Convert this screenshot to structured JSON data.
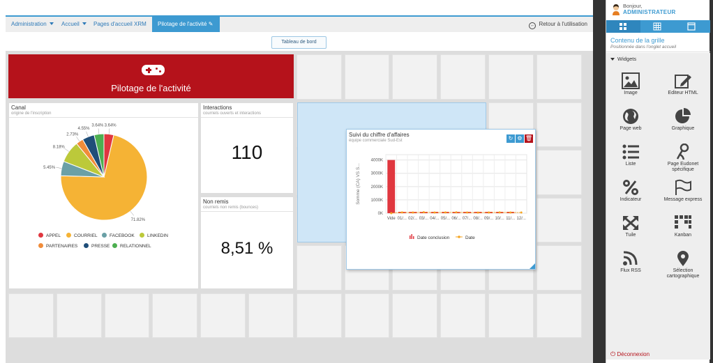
{
  "breadcrumb": {
    "items": [
      "Administration",
      "Accueil",
      "Pages d'accueil XRM"
    ],
    "active": "Pilotage de l'activité",
    "back_label": "Retour à l'utilisation"
  },
  "toolbar": {
    "dashboard_button": "Tableau de bord"
  },
  "title_widget": {
    "title": "Pilotage de l'activité"
  },
  "canal": {
    "title": "Canal",
    "subtitle": "origine de l'inscription",
    "chart_data": {
      "type": "pie",
      "categories": [
        "APPEL",
        "COURRIEL",
        "FACEBOOK",
        "LINKEDIN",
        "PARTENAIRES",
        "PRESSE",
        "RELATIONNEL"
      ],
      "values": [
        3.64,
        71.82,
        5.45,
        8.18,
        2.73,
        4.55,
        3.64
      ],
      "labels": [
        "3.64%",
        "71.82%",
        "5.45%",
        "8.18%",
        "2.73%",
        "4.55%",
        "3.64%"
      ],
      "colors": [
        "#e0373f",
        "#f5b335",
        "#6aa0a6",
        "#bcc93a",
        "#f08c3a",
        "#1f4e79",
        "#4caf50"
      ],
      "legend_placement": "bottom"
    }
  },
  "interactions": {
    "title": "Interactions",
    "subtitle": "courriels ouverts et interactions",
    "value": "110"
  },
  "non_remis": {
    "title": "Non remis",
    "subtitle": "courriels non remis (bounces)",
    "value": "8,51 %"
  },
  "ca_widget": {
    "title": "Suivi du chiffre d'affaires",
    "subtitle": "équipe commerciale Sud-Est",
    "chart_data": {
      "type": "bar",
      "ylabel": "Somme (CA) VS S...",
      "ytick_labels": [
        "0K",
        "1000K",
        "2000K",
        "3000K",
        "4000K"
      ],
      "ylim": [
        0,
        4400
      ],
      "categories": [
        "Vide",
        "01/...",
        "02/...",
        "03/...",
        "04/...",
        "05/...",
        "06/...",
        "07/...",
        "08/...",
        "09/...",
        "10/...",
        "11/...",
        "12/..."
      ],
      "series": [
        {
          "name": "Date conclusion",
          "type": "bar",
          "values": [
            4000,
            60,
            70,
            50,
            60,
            70,
            60,
            55,
            40,
            50,
            55,
            60,
            0
          ]
        },
        {
          "name": "Date",
          "type": "line",
          "values": [
            0,
            60,
            50,
            70,
            55,
            60,
            65,
            50,
            45,
            55,
            60,
            55,
            50
          ]
        }
      ],
      "legend_placement": "bottom",
      "grid": true
    }
  },
  "sidebar": {
    "greeting": "Bonjour,",
    "user": "ADMINISTRATEUR",
    "section_title": "Contenu de la grille",
    "section_subtitle": "Positionnée dans l'onglet accueil",
    "widgets_label": "Widgets",
    "widgets": [
      {
        "label": "Image",
        "icon": "image-icon"
      },
      {
        "label": "Editeur HTML",
        "icon": "html-editor-icon"
      },
      {
        "label": "Page web",
        "icon": "globe-icon"
      },
      {
        "label": "Graphique",
        "icon": "pie-chart-icon"
      },
      {
        "label": "Liste",
        "icon": "list-icon"
      },
      {
        "label": "Page Eudonet spécifique",
        "icon": "specific-page-icon"
      },
      {
        "label": "Indicateur",
        "icon": "percent-icon"
      },
      {
        "label": "Message express",
        "icon": "flag-icon"
      },
      {
        "label": "Tuile",
        "icon": "tile-icon"
      },
      {
        "label": "Kanban",
        "icon": "kanban-icon"
      },
      {
        "label": "Flux RSS",
        "icon": "rss-icon"
      },
      {
        "label": "Sélection cartographique",
        "icon": "map-pin-icon"
      }
    ],
    "logout": "Déconnexion"
  },
  "colors": {
    "accent": "#3d9ad1",
    "brand_red": "#b5121b",
    "selection": "#cfe6f7"
  }
}
